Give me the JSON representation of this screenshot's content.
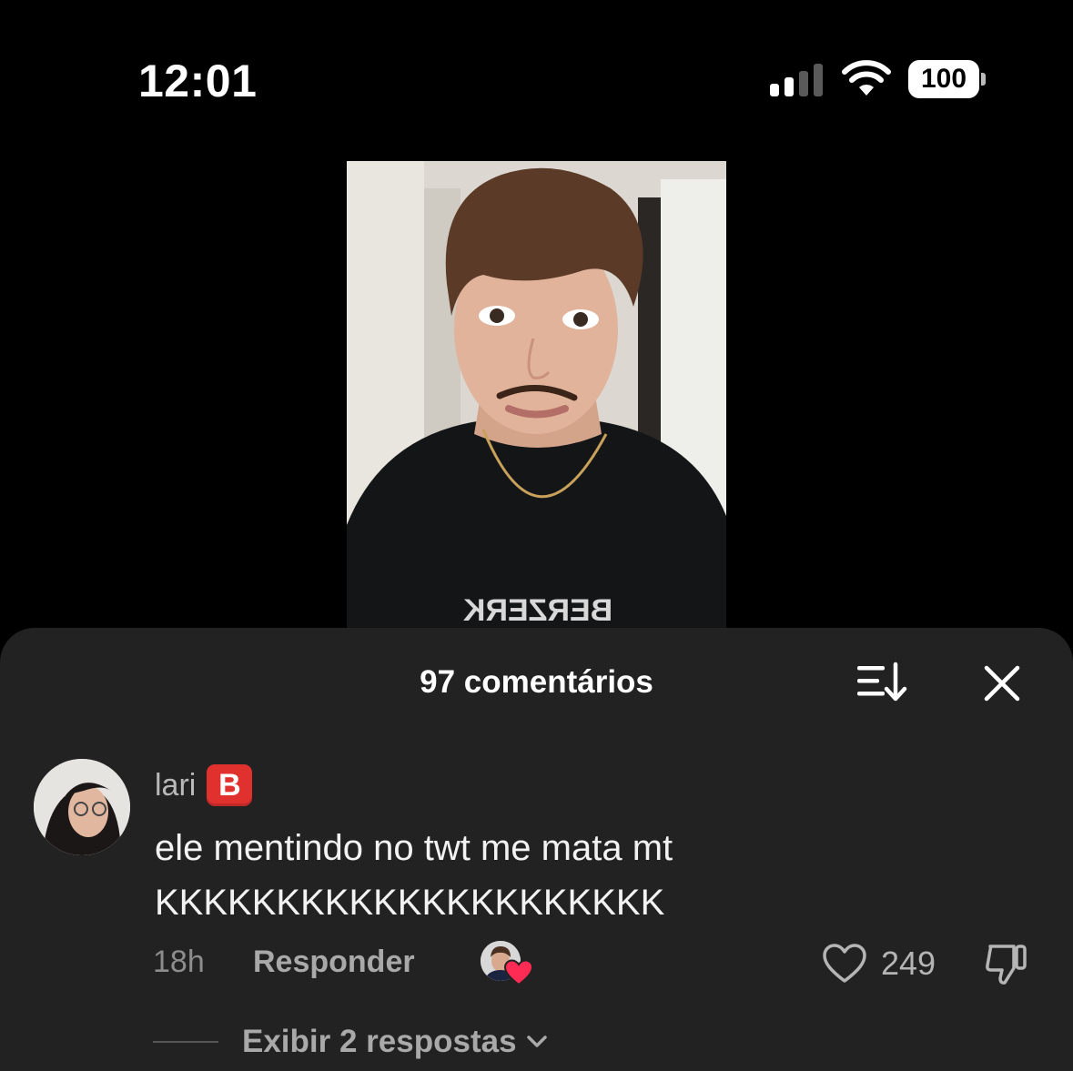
{
  "status_bar": {
    "time": "12:01",
    "battery": "100",
    "icons": [
      "cellular-signal-icon",
      "wifi-icon",
      "battery-icon"
    ]
  },
  "video": {
    "shirt_text": "BERZERK"
  },
  "comments_sheet": {
    "title": "97 comentários",
    "icons": [
      "sort-icon",
      "close-icon"
    ],
    "comment": {
      "username": "lari",
      "badge": "B",
      "text_line1": "ele mentindo no twt me mata mt",
      "text_line2": "KKKKKKKKKKKKKKKKKKKKK",
      "time_ago": "18h",
      "reply_label": "Responder",
      "like_count": "249",
      "liked_by_creator": true,
      "view_replies": "Exibir 2 respostas"
    }
  },
  "colors": {
    "sheet_bg": "#222222",
    "heart_red": "#fe2c55",
    "badge_red": "#e0312f"
  }
}
